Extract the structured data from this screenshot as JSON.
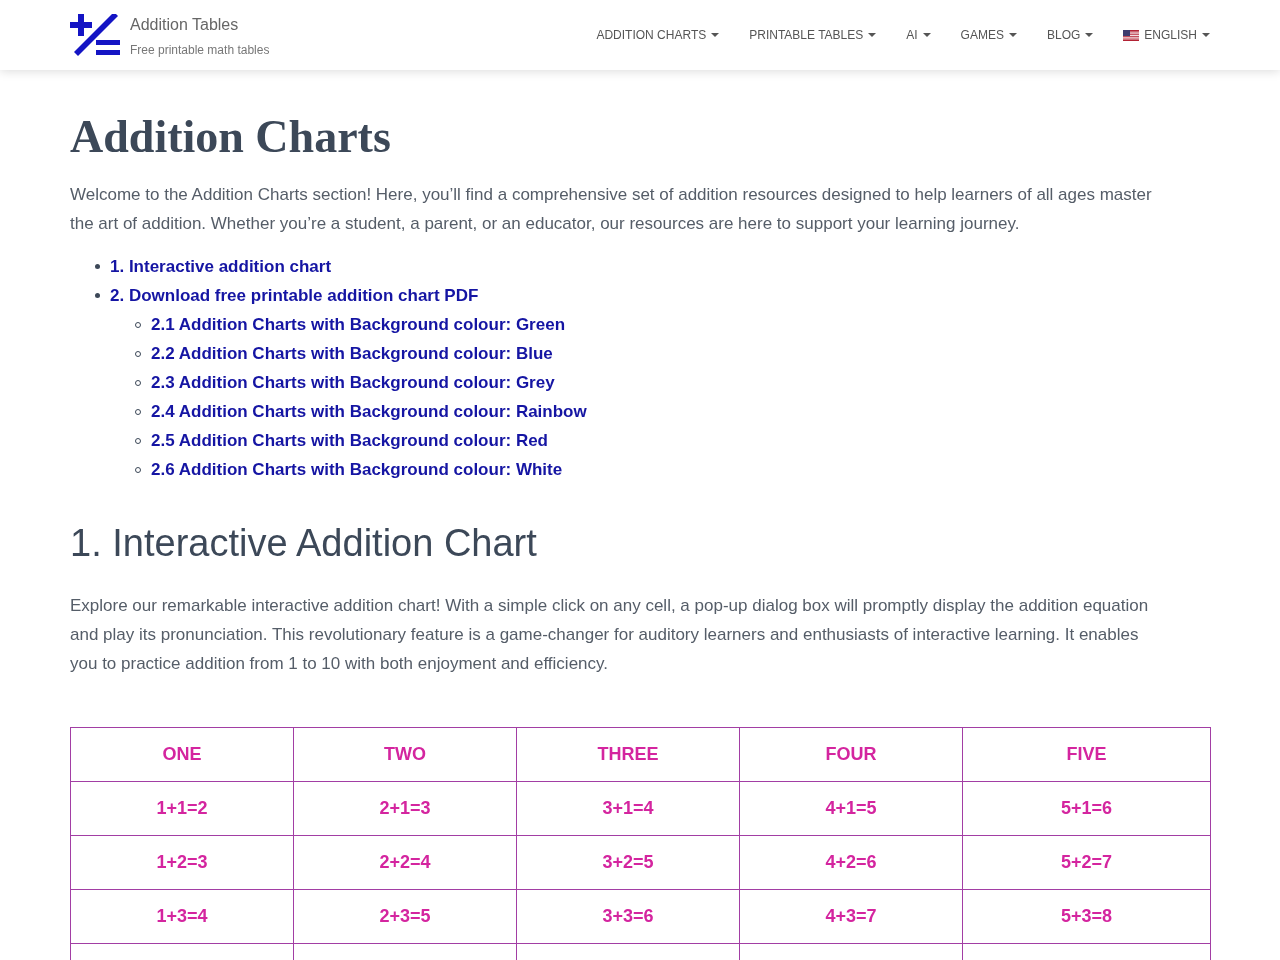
{
  "header": {
    "site_title": "Addition Tables",
    "tagline": "Free printable math tables",
    "nav": [
      {
        "label": "ADDITION CHARTS",
        "kind": "menu"
      },
      {
        "label": "PRINTABLE TABLES",
        "kind": "menu"
      },
      {
        "label": "AI",
        "kind": "menu"
      },
      {
        "label": "GAMES",
        "kind": "menu"
      },
      {
        "label": "BLOG",
        "kind": "menu"
      },
      {
        "label": "ENGLISH",
        "kind": "language"
      }
    ]
  },
  "page_title": "Addition Charts",
  "intro": "Welcome to the Addition Charts section! Here, you’ll find a comprehensive set of addition resources designed to help learners of all ages master the art of addition. Whether you’re a student, a parent, or an educator, our resources are here to support your learning journey.",
  "contents": [
    {
      "label": "1. Interactive addition chart"
    },
    {
      "label": "2. Download free printable addition chart PDF",
      "children": [
        {
          "label": "2.1 Addition Charts with Background colour: Green"
        },
        {
          "label": "2.2 Addition Charts with Background colour: Blue"
        },
        {
          "label": "2.3 Addition Charts with Background colour: Grey"
        },
        {
          "label": "2.4 Addition Charts with Background colour: Rainbow"
        },
        {
          "label": "2.5 Addition Charts with Background colour: Red"
        },
        {
          "label": "2.6 Addition Charts with Background colour: White"
        }
      ]
    }
  ],
  "section_heading": "1. Interactive Addition Chart",
  "section_text": "Explore our remarkable interactive addition chart! With a simple click on any cell, a pop-up dialog box will promptly display the addition equation and play its pronunciation. This revolutionary feature is a game-changer for auditory learners and enthusiasts of interactive learning. It enables you to practice addition from 1 to 10 with both enjoyment and efficiency.",
  "table": {
    "columns": [
      "ONE",
      "TWO",
      "THREE",
      "FOUR",
      "FIVE"
    ],
    "rows": [
      [
        "1+1=2",
        "2+1=3",
        "3+1=4",
        "4+1=5",
        "5+1=6"
      ],
      [
        "1+2=3",
        "2+2=4",
        "3+2=5",
        "4+2=6",
        "5+2=7"
      ],
      [
        "1+3=4",
        "2+3=5",
        "3+3=6",
        "4+3=7",
        "5+3=8"
      ]
    ]
  }
}
